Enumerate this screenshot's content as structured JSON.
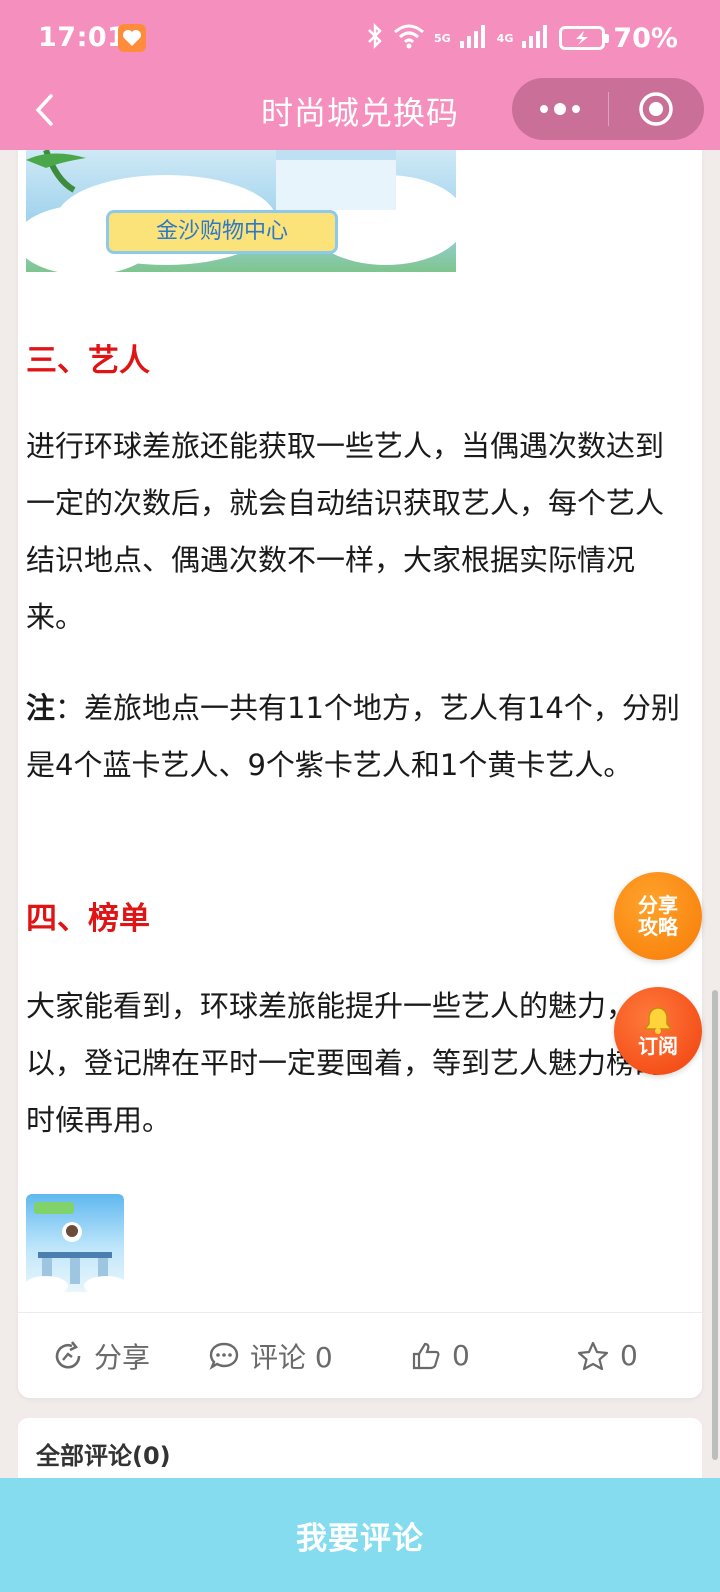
{
  "status_bar": {
    "time": "17:01",
    "network_5g": "5G",
    "network_4g": "4G",
    "battery": "70%"
  },
  "nav": {
    "title": "时尚城兑换码"
  },
  "banner": {
    "label": "金沙购物中心"
  },
  "article": {
    "section3_heading": "三、艺人",
    "section3_text": "进行环球差旅还能获取一些艺人，当偶遇次数达到一定的次数后，就会自动结识获取艺人，每个艺人结识地点、偶遇次数不一样，大家根据实际情况来。",
    "note_label": "注",
    "note_text": "：差旅地点一共有11个地方，艺人有14个，分别是4个蓝卡艺人、9个紫卡艺人和1个黄卡艺人。",
    "section4_heading": "四、榜单",
    "section4_text": "大家能看到，环球差旅能提升一些艺人的魅力，所以，登记牌在平时一定要囤着，等到艺人魅力榜的时候再用。"
  },
  "actions": {
    "share": "分享",
    "comment": "评论 0",
    "like": "0",
    "favorite": "0"
  },
  "floating": {
    "share_line1": "分享",
    "share_line2": "攻略",
    "subscribe": "订阅"
  },
  "comments": {
    "title": "全部评论(0)"
  },
  "bottom": {
    "comment_button": "我要评论"
  },
  "colors": {
    "header": "#f58fbd",
    "heading_red": "#e01414",
    "bottom_bar": "#86dcef"
  }
}
